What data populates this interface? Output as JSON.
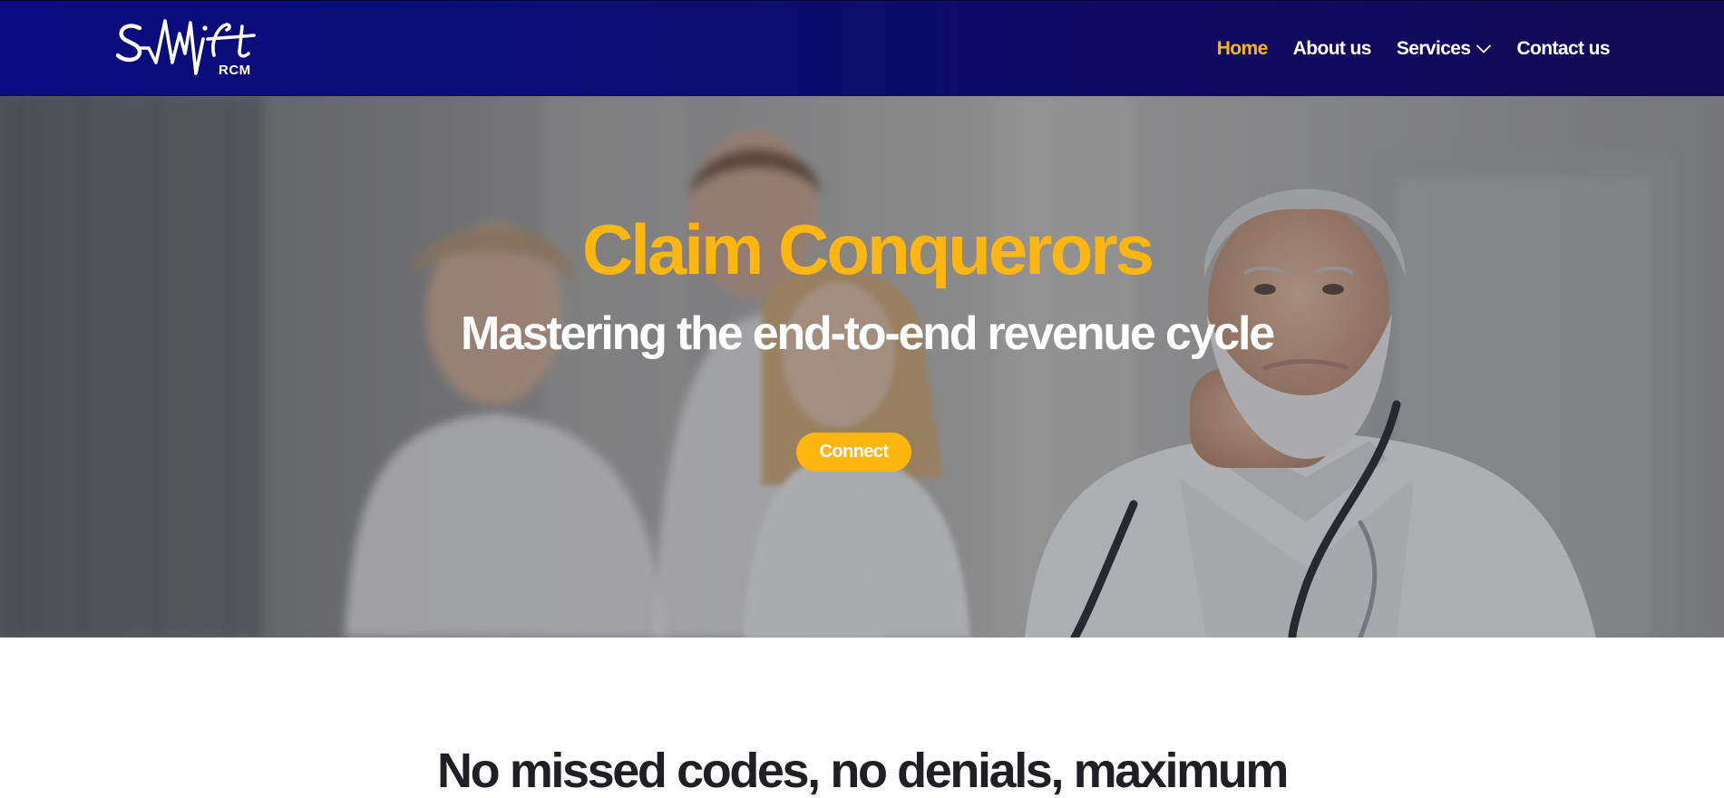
{
  "header": {
    "logo_text": "Swift",
    "logo_sub": "RCM",
    "nav": [
      {
        "label": "Home",
        "active": true
      },
      {
        "label": "About us"
      },
      {
        "label": "Services",
        "has_dropdown": true
      },
      {
        "label": "Contact us"
      }
    ]
  },
  "hero": {
    "title": "Claim Conquerors",
    "subtitle": "Mastering the end-to-end revenue cycle",
    "button_label": "Connect",
    "image": "doctors-team-photo"
  },
  "section": {
    "heading": "No missed codes, no denials, maximum"
  },
  "colors": {
    "header_bg": "#0c0b6e",
    "accent": "#ffb70f",
    "text_dark": "#1f1f24"
  }
}
